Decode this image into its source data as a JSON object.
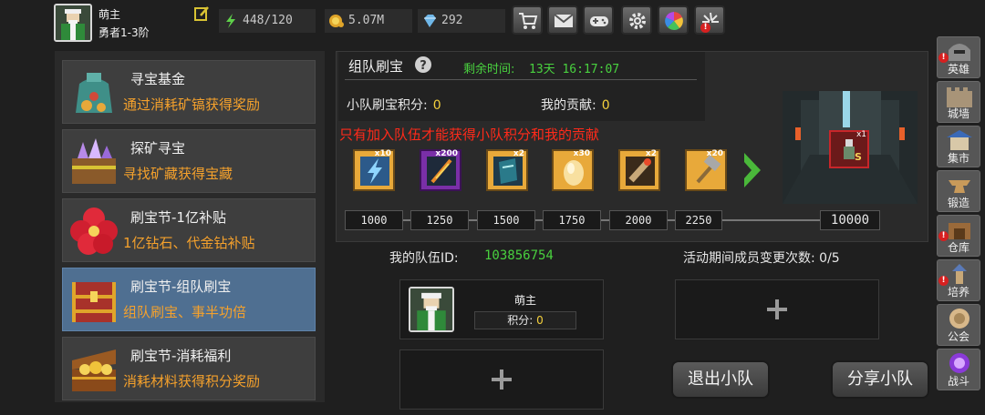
{
  "player": {
    "name": "萌主",
    "rank": "勇者1-3阶"
  },
  "resources": {
    "energy": "448/120",
    "gold": "5.07M",
    "gems": "292"
  },
  "toolbar": {
    "icons": [
      "shop-cart-icon",
      "mail-icon",
      "gamepad-icon",
      "gear-icon",
      "color-wheel-icon",
      "announcement-icon"
    ]
  },
  "menu": {
    "items": [
      {
        "title": "寻宝基金",
        "subtitle": "通过消耗矿镐获得奖励",
        "icon": "treasure-bag-icon"
      },
      {
        "title": "探矿寻宝",
        "subtitle": "寻找矿藏获得宝藏",
        "icon": "crystal-chest-icon"
      },
      {
        "title": "刷宝节-1亿补贴",
        "subtitle": "1亿钻石、代金钻补贴",
        "icon": "red-flower-icon"
      },
      {
        "title": "刷宝节-组队刷宝",
        "subtitle": "组队刷宝、事半功倍",
        "icon": "red-chest-icon"
      },
      {
        "title": "刷宝节-消耗福利",
        "subtitle": "消耗材料获得积分奖励",
        "icon": "gold-chest-icon"
      }
    ]
  },
  "event": {
    "title": "组队刷宝",
    "time_label": "剩余时间:",
    "time_value": "13天 16:17:07",
    "team_score_label": "小队刷宝积分:",
    "team_score": "0",
    "my_contrib_label": "我的贡献:",
    "my_contrib": "0",
    "warning": "只有加入队伍才能获得小队积分和我的贡献"
  },
  "rewards": [
    {
      "count": "x10",
      "icon": "lightning-scroll-icon"
    },
    {
      "count": "x200",
      "icon": "fire-feather-icon"
    },
    {
      "count": "x2",
      "icon": "blue-book-icon"
    },
    {
      "count": "x30",
      "icon": "golden-egg-icon"
    },
    {
      "count": "x2",
      "icon": "fire-scroll-icon"
    },
    {
      "count": "x20",
      "icon": "hammer-icon"
    }
  ],
  "milestones": [
    "1000",
    "1250",
    "1500",
    "1750",
    "2000",
    "2250",
    "10000"
  ],
  "final_prize": {
    "count": "x1",
    "mark": "S"
  },
  "team": {
    "id_label": "我的队伍ID:",
    "id": "103856754",
    "changes_label": "活动期间成员变更次数:",
    "changes": "0/5",
    "member_name": "萌主",
    "member_score_label": "积分:",
    "member_score": "0"
  },
  "buttons": {
    "leave": "退出小队",
    "share": "分享小队"
  },
  "sidebar": [
    {
      "label": "英雄",
      "alert": true
    },
    {
      "label": "城墙",
      "alert": false
    },
    {
      "label": "集市",
      "alert": false
    },
    {
      "label": "锻造",
      "alert": false
    },
    {
      "label": "仓库",
      "alert": true
    },
    {
      "label": "培养",
      "alert": true
    },
    {
      "label": "公会",
      "alert": false
    },
    {
      "label": "战斗",
      "alert": false
    }
  ],
  "colors": {
    "accent_green": "#49d13f",
    "warning_red": "#ff2a1a",
    "subtitle_orange": "#f5a12c",
    "selected_blue": "#4f6f91"
  }
}
